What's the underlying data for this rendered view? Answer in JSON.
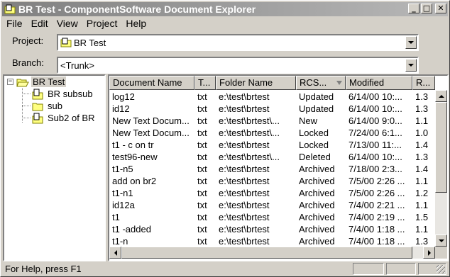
{
  "window": {
    "title": "BR Test - ComponentSoftware Document Explorer",
    "buttons": {
      "minimize": "_",
      "maximize": "□",
      "close": "✕"
    }
  },
  "menu": [
    "File",
    "Edit",
    "View",
    "Project",
    "Help"
  ],
  "project": {
    "label": "Project:",
    "value": "BR Test"
  },
  "branch": {
    "label": "Branch:",
    "value": "<Trunk>"
  },
  "tree": {
    "root": "BR Test",
    "children": [
      "BR subsub",
      "sub",
      "Sub2 of BR"
    ]
  },
  "list": {
    "columns": [
      "Document Name",
      "T...",
      "Folder Name",
      "RCS...",
      "Modified",
      "R..."
    ],
    "rows": [
      [
        "log12",
        "txt",
        "e:\\test\\brtest",
        "Updated",
        "6/14/00 10:...",
        "1.3"
      ],
      [
        "id12",
        "txt",
        "e:\\test\\brtest",
        "Updated",
        "6/14/00 10:...",
        "1.3"
      ],
      [
        "New Text Docum...",
        "txt",
        "e:\\test\\brtest\\...",
        "New",
        "6/14/00 9:0...",
        "1.1"
      ],
      [
        "New Text Docum...",
        "txt",
        "e:\\test\\brtest\\...",
        "Locked",
        "7/24/00 6:1...",
        "1.0"
      ],
      [
        "t1 - c on tr",
        "txt",
        "e:\\test\\brtest",
        "Locked",
        "7/13/00 11:...",
        "1.4"
      ],
      [
        "test96-new",
        "txt",
        "e:\\test\\brtest\\...",
        "Deleted",
        "6/14/00 10:...",
        "1.3"
      ],
      [
        "t1-n5",
        "txt",
        "e:\\test\\brtest",
        "Archived",
        "7/18/00 2:3...",
        "1.4"
      ],
      [
        "add on br2",
        "txt",
        "e:\\test\\brtest",
        "Archived",
        "7/5/00 2:26 ...",
        "1.1"
      ],
      [
        "t1-n1",
        "txt",
        "e:\\test\\brtest",
        "Archived",
        "7/5/00 2:26 ...",
        "1.2"
      ],
      [
        "id12a",
        "txt",
        "e:\\test\\brtest",
        "Archived",
        "7/4/00 2:21 ...",
        "1.1"
      ],
      [
        "t1",
        "txt",
        "e:\\test\\brtest",
        "Archived",
        "7/4/00 2:19 ...",
        "1.5"
      ],
      [
        "t1 -added",
        "txt",
        "e:\\test\\brtest",
        "Archived",
        "7/4/00 1:18 ...",
        "1.1"
      ],
      [
        "t1-n",
        "txt",
        "e:\\test\\brtest",
        "Archived",
        "7/4/00 1:18 ...",
        "1.3"
      ]
    ]
  },
  "status": {
    "text": "For Help, press F1"
  }
}
